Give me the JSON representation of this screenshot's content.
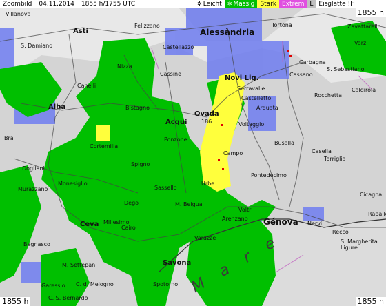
{
  "header": {
    "title": "Zoombild",
    "date": "04.11.2014",
    "time": "1855 h/1755 UTC"
  },
  "legend": [
    {
      "label": "Leicht",
      "icon": "light-snow-icon",
      "color": "#ffffff",
      "text_color": "#000000"
    },
    {
      "label": "Mässig",
      "icon": "moderate-snow-icon",
      "color": "#00bf00",
      "text_color": "#ffffff"
    },
    {
      "label": "Stark",
      "icon": "",
      "color": "#ffff40",
      "text_color": "#000000"
    },
    {
      "label": "Extrem",
      "icon": "",
      "color": "#e050e0",
      "text_color": "#ffffff"
    },
    {
      "label": "L",
      "icon": "",
      "color": "#c0c0c0",
      "text_color": "#000000"
    },
    {
      "label": "Eisglätte !H",
      "icon": "",
      "color": "#ffffff",
      "text_color": "#000000"
    }
  ],
  "corners": {
    "top_right": "1855 h",
    "bottom_left": "1855 h",
    "bottom_right": "1855 h"
  },
  "places": {
    "alessandria": "Alessàndria",
    "genova": "Génova",
    "savona": "Savona",
    "asti": "Asti",
    "alba": "Alba",
    "novi": "Novi Lig.",
    "ovada": "Ovada",
    "acqui": "Acqui",
    "tortona": "Tortona",
    "nizza": "Nizza",
    "canelli": "Canelli",
    "cassine": "Cassine",
    "felizzano": "Felizzano",
    "castellazzo": "Castellazzo",
    "serravalle": "Serravalle",
    "arquata": "Arquata",
    "voltaggio": "Voltaggio",
    "busalla": "Busalla",
    "campo": "Campo",
    "urbe": "Urbe",
    "sassello": "Sassello",
    "voltri": "Voltri",
    "arenzano": "Arenzano",
    "varazze": "Varazze",
    "nervi": "Nervi",
    "recco": "Recco",
    "rapallo": "Rapallo",
    "cicagna": "Cicagna",
    "torriglia": "Torriglia",
    "casella": "Casella",
    "rocchetta": "Rocchetta",
    "carbagna": "Carbagna",
    "cassano": "Cassano",
    "zavattarello": "Zavattarello",
    "varzi": "Varzi",
    "caldirola": "Caldirola",
    "s_sebastiano": "S. Sebastiano",
    "bra": "Bra",
    "villanova": "Villanova",
    "s_damiano": "S. Damiano",
    "dogliani": "Dogliani",
    "murazzano": "Murazzano",
    "monesiglio": "Monesiglio",
    "ceva": "Ceva",
    "bagnasco": "Bagnasco",
    "garessio": "Garessio",
    "millesimo": "Millesimo",
    "cairo": "Cairo",
    "dego": "Dego",
    "spigno": "Spigno",
    "cortemilia": "Cortemilia",
    "bistagno": "Bistagno",
    "ponzone": "Ponzone",
    "castelletto": "Castelletto",
    "pontedecimo": "Pontedecimo",
    "spotorno": "Spotorno",
    "m_settepani": "M. Settepani",
    "c_d_melogno": "C. d. Melogno",
    "c_s_bernardo": "C. S. Bernardo",
    "m_beigua": "M. Beigua",
    "s_margherita": "S. Margherita Ligure",
    "ovada_elev": "186"
  },
  "sea_text": "M a r e"
}
